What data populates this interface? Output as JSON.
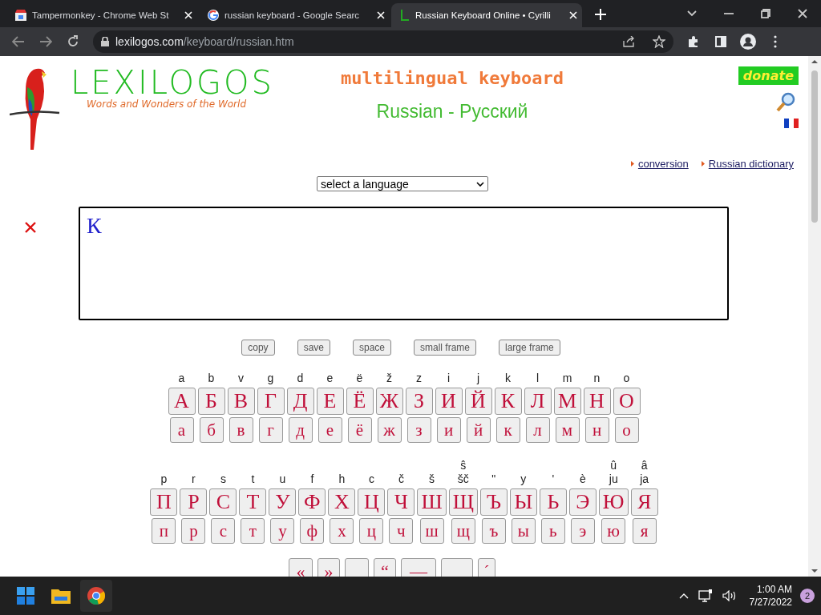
{
  "browser": {
    "tabs": [
      {
        "title": "Tampermonkey - Chrome Web St",
        "selected": false
      },
      {
        "title": "russian keyboard - Google Searc",
        "selected": false
      },
      {
        "title": "Russian Keyboard Online • Cyrilli",
        "selected": true
      }
    ],
    "address": {
      "domain": "lexilogos.com",
      "path": "/keyboard/russian.htm"
    }
  },
  "page": {
    "logo": {
      "title": "LEXILOGOS",
      "tagline": "Words and Wonders of the World"
    },
    "heading": "multilingual keyboard",
    "subheading": "Russian - Русский",
    "donate": "donate",
    "links": [
      "conversion",
      "Russian dictionary"
    ],
    "language_select": {
      "value": "select a language"
    },
    "text_area": {
      "value": "К"
    },
    "buttons": [
      "copy",
      "save",
      "space",
      "small frame",
      "large frame"
    ],
    "keyboard_rows": [
      {
        "keys": [
          {
            "translit": "a",
            "upper": "А",
            "lower": "а"
          },
          {
            "translit": "b",
            "upper": "Б",
            "lower": "б"
          },
          {
            "translit": "v",
            "upper": "В",
            "lower": "в"
          },
          {
            "translit": "g",
            "upper": "Г",
            "lower": "г"
          },
          {
            "translit": "d",
            "upper": "Д",
            "lower": "д"
          },
          {
            "translit": "e",
            "upper": "Е",
            "lower": "е"
          },
          {
            "translit": "ë",
            "upper": "Ё",
            "lower": "ё"
          },
          {
            "translit": "ž",
            "upper": "Ж",
            "lower": "ж"
          },
          {
            "translit": "z",
            "upper": "З",
            "lower": "з"
          },
          {
            "translit": "i",
            "upper": "И",
            "lower": "и"
          },
          {
            "translit": "j",
            "upper": "Й",
            "lower": "й"
          },
          {
            "translit": "k",
            "upper": "К",
            "lower": "к"
          },
          {
            "translit": "l",
            "upper": "Л",
            "lower": "л"
          },
          {
            "translit": "m",
            "upper": "М",
            "lower": "м"
          },
          {
            "translit": "n",
            "upper": "Н",
            "lower": "н"
          },
          {
            "translit": "o",
            "upper": "О",
            "lower": "о"
          }
        ]
      },
      {
        "keys": [
          {
            "translit": "p",
            "upper": "П",
            "lower": "п"
          },
          {
            "translit": "r",
            "upper": "Р",
            "lower": "р"
          },
          {
            "translit": "s",
            "upper": "С",
            "lower": "с"
          },
          {
            "translit": "t",
            "upper": "Т",
            "lower": "т"
          },
          {
            "translit": "u",
            "upper": "У",
            "lower": "у"
          },
          {
            "translit": "f",
            "upper": "Ф",
            "lower": "ф"
          },
          {
            "translit": "h",
            "upper": "Х",
            "lower": "х"
          },
          {
            "translit": "c",
            "upper": "Ц",
            "lower": "ц"
          },
          {
            "translit": "č",
            "upper": "Ч",
            "lower": "ч"
          },
          {
            "translit": "š",
            "upper": "Ш",
            "lower": "ш"
          },
          {
            "accent": "ŝ",
            "translit": "šč",
            "upper": "Щ",
            "lower": "щ"
          },
          {
            "translit": "\"",
            "upper": "Ъ",
            "lower": "ъ"
          },
          {
            "translit": "y",
            "upper": "Ы",
            "lower": "ы"
          },
          {
            "translit": "'",
            "upper": "Ь",
            "lower": "ь"
          },
          {
            "translit": "è",
            "upper": "Э",
            "lower": "э"
          },
          {
            "accent": "û",
            "translit": "ju",
            "upper": "Ю",
            "lower": "ю"
          },
          {
            "accent": "â",
            "translit": "ja",
            "upper": "Я",
            "lower": "я"
          }
        ]
      }
    ],
    "punctuation_keys": [
      {
        "kind": "key",
        "char": "«"
      },
      {
        "kind": "key",
        "char": "»"
      },
      {
        "kind": "hidden"
      },
      {
        "kind": "key",
        "char": "“"
      },
      {
        "kind": "key",
        "char": "—"
      },
      {
        "kind": "hidden"
      },
      {
        "kind": "key",
        "char": "´"
      }
    ]
  },
  "taskbar": {
    "time": "1:00 AM",
    "date": "7/27/2022",
    "notifications": "2"
  }
}
